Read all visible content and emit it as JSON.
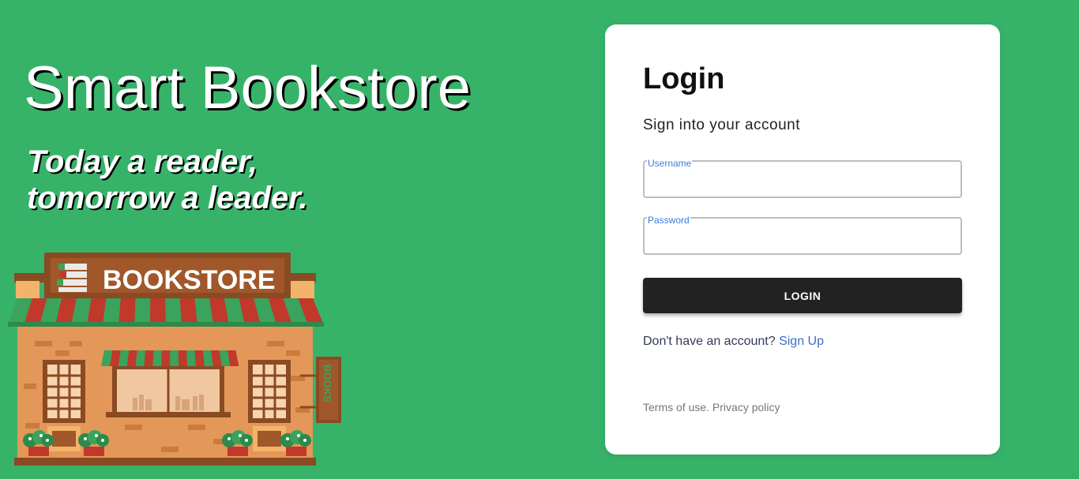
{
  "hero": {
    "title": "Smart Bookstore",
    "tagline_line1": "Today a reader,",
    "tagline_line2": "tomorrow a leader.",
    "store_sign": "BOOKSTORE",
    "side_sign": "BOOKS"
  },
  "login": {
    "title": "Login",
    "subtitle": "Sign into your account",
    "username_label": "Username",
    "username_value": "",
    "password_label": "Password",
    "password_value": "",
    "button_label": "LOGIN",
    "signup_prompt": "Don't have an account?",
    "signup_link": "Sign Up",
    "terms_link": "Terms of use.",
    "privacy_link": "Privacy policy"
  },
  "colors": {
    "background": "#37b369",
    "card": "#ffffff",
    "button": "#222222",
    "link": "#3f6cc4",
    "label_accent": "#3b7ddd"
  }
}
